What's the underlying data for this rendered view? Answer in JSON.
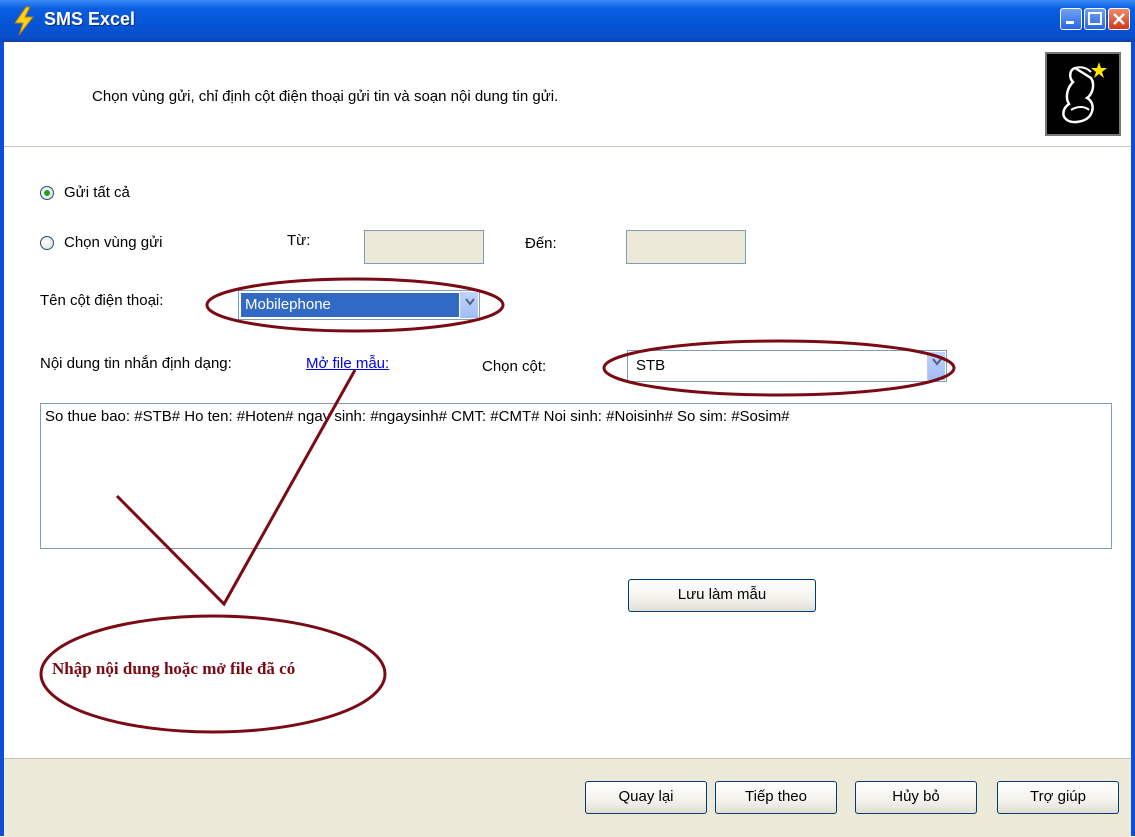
{
  "window": {
    "title": "SMS Excel"
  },
  "header": {
    "instruction": "Chọn vùng gửi, chỉ định cột điện thoại gửi tin và soạn nội dung tin gửi."
  },
  "range": {
    "send_all_label": "Gửi tất cả",
    "send_all_selected": true,
    "choose_range_label": "Chọn vùng gửi",
    "choose_range_selected": false,
    "from_label": "Từ:",
    "from_value": "",
    "to_label": "Đến:",
    "to_value": ""
  },
  "phone_column": {
    "label": "Tên cột điện thoại:",
    "selected": "Mobilephone"
  },
  "message": {
    "label": "Nội dung tin nhắn định dạng:",
    "open_template_link": "Mở file mẫu:",
    "choose_column_label": "Chọn cột:",
    "column_selected": "STB",
    "content": "So thue bao: #STB# Ho ten: #Hoten# ngay sinh: #ngaysinh# CMT: #CMT# Noi sinh: #Noisinh# So sim: #Sosim#",
    "save_template_button": "Lưu làm mẫu"
  },
  "annotation": {
    "text": "Nhập nội dung hoặc mở file đã có",
    "color": "#7a0a14"
  },
  "footer": {
    "back_button": "Quay lại",
    "next_button": "Tiếp theo",
    "cancel_button": "Hủy bỏ",
    "help_button": "Trợ giúp"
  },
  "colors": {
    "titlebar": "#0554d6",
    "footer_bg": "#ece9d8",
    "selection": "#316ac5",
    "link": "#0000ee"
  }
}
